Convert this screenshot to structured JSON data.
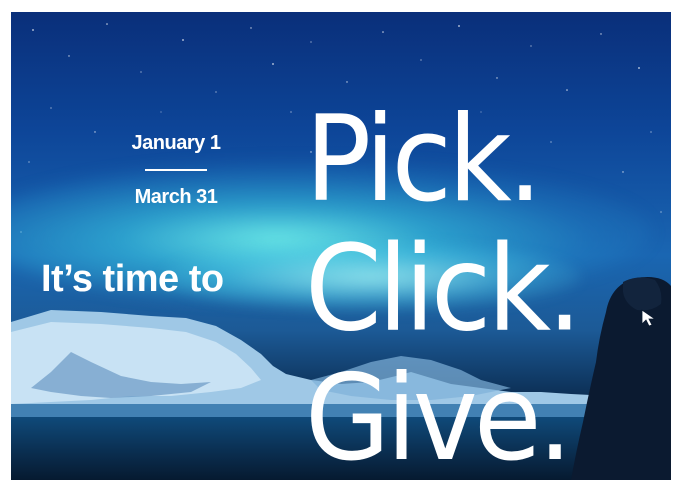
{
  "promo": {
    "date_start": "January 1",
    "date_end": "March 31",
    "tagline": "It’s time to",
    "headline": {
      "line1": "Pick.",
      "line2": "Click.",
      "line3": "Give."
    }
  },
  "colors": {
    "sky": "#0d4598",
    "aurora": "#78fff0",
    "text": "#ffffff",
    "water": "#0a2c4d"
  },
  "icons": {
    "cursor": "mouse-cursor-icon"
  }
}
